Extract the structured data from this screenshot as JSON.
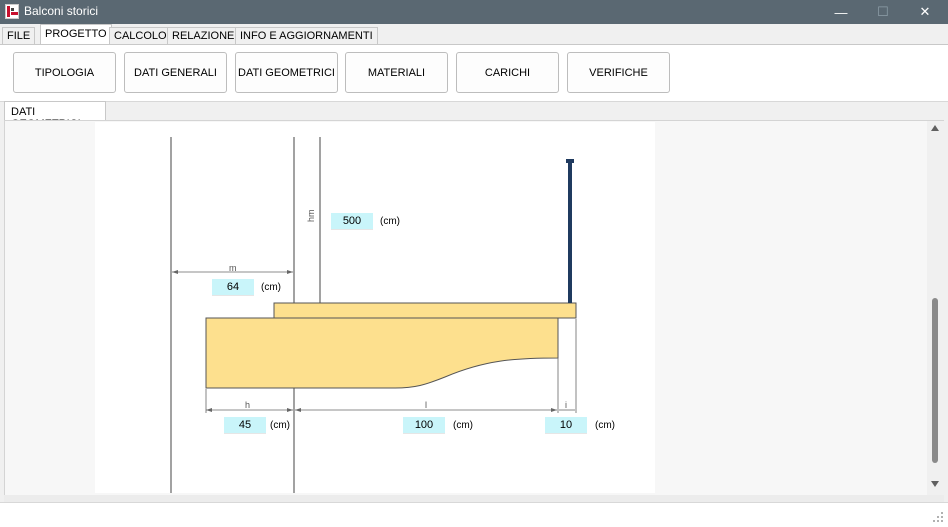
{
  "window": {
    "title": "Balconi storici",
    "controls": {
      "minimize": "—",
      "maximize": "☐",
      "close": "✕"
    }
  },
  "menu_tabs": [
    "FILE",
    "PROGETTO",
    "CALCOLO",
    "RELAZIONE",
    "INFO E AGGIORNAMENTI"
  ],
  "active_menu_tab": "PROGETTO",
  "ribbon": {
    "buttons": [
      "TIPOLOGIA",
      "DATI GENERALI",
      "DATI GEOMETRICI",
      "MATERIALI",
      "CARICHI",
      "VERIFICHE"
    ]
  },
  "section_tab": "DATI GEOMETRICI",
  "drawing": {
    "labels": {
      "hm": "hm",
      "m": "m",
      "h": "h",
      "l": "l",
      "i": "i"
    },
    "fields": {
      "hm": {
        "value": "500",
        "unit": "(cm)"
      },
      "m": {
        "value": "64",
        "unit": "(cm)"
      },
      "h": {
        "value": "45",
        "unit": "(cm)"
      },
      "l": {
        "value": "100",
        "unit": "(cm)"
      },
      "i": {
        "value": "10",
        "unit": "(cm)"
      }
    },
    "colors": {
      "slab": "#fde08e",
      "railing": "#1f3a5f",
      "field_bg": "#c9f5fa"
    }
  }
}
